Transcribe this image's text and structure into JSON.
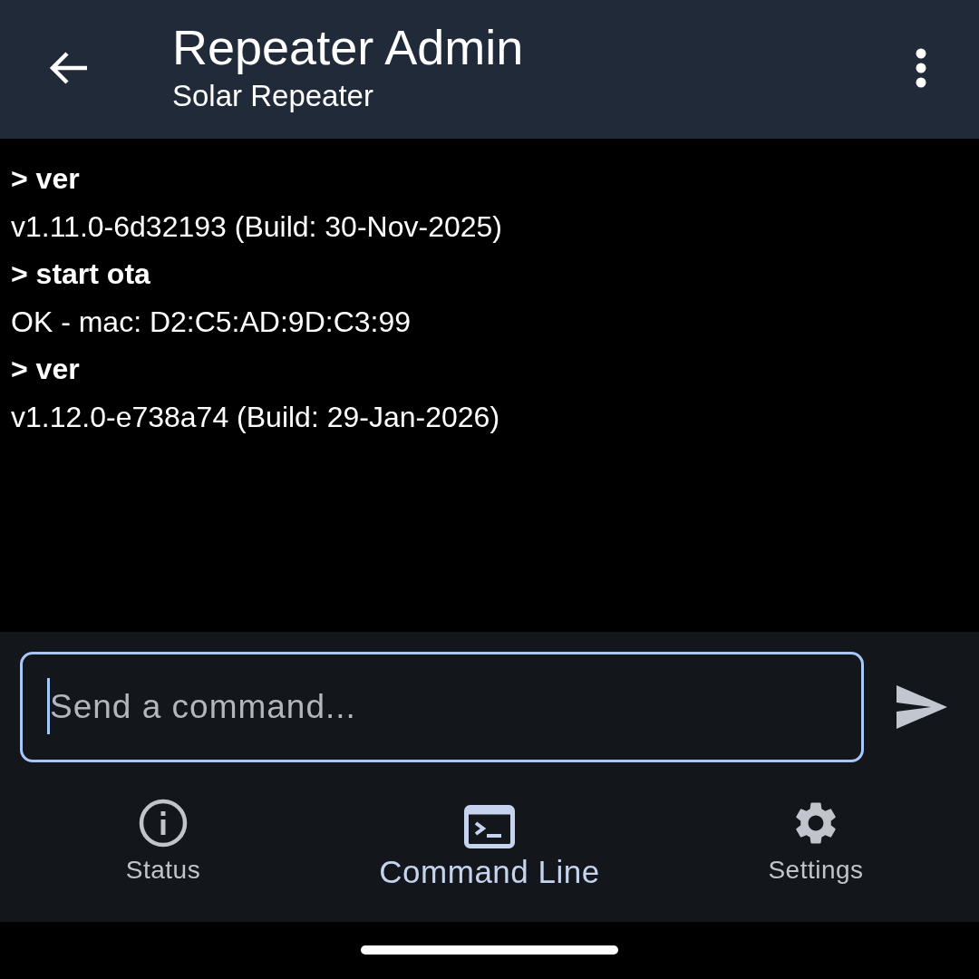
{
  "app_bar": {
    "title": "Repeater Admin",
    "subtitle": "Solar Repeater"
  },
  "console": {
    "lines": [
      {
        "kind": "command",
        "text": "> ver"
      },
      {
        "kind": "output",
        "text": "v1.11.0-6d32193 (Build: 30-Nov-2025)"
      },
      {
        "kind": "command",
        "text": "> start ota"
      },
      {
        "kind": "output",
        "text": "OK - mac: D2:C5:AD:9D:C3:99"
      },
      {
        "kind": "command",
        "text": "> ver"
      },
      {
        "kind": "output",
        "text": "v1.12.0-e738a74 (Build: 29-Jan-2026)"
      }
    ]
  },
  "command_input": {
    "placeholder": "Send a command...",
    "focused": true
  },
  "bottom_nav": [
    {
      "label": "Status",
      "kind": "info",
      "selected": false
    },
    {
      "label": "Command Line",
      "kind": "terminal",
      "selected": true
    },
    {
      "label": "Settings",
      "kind": "gear",
      "selected": false
    }
  ]
}
